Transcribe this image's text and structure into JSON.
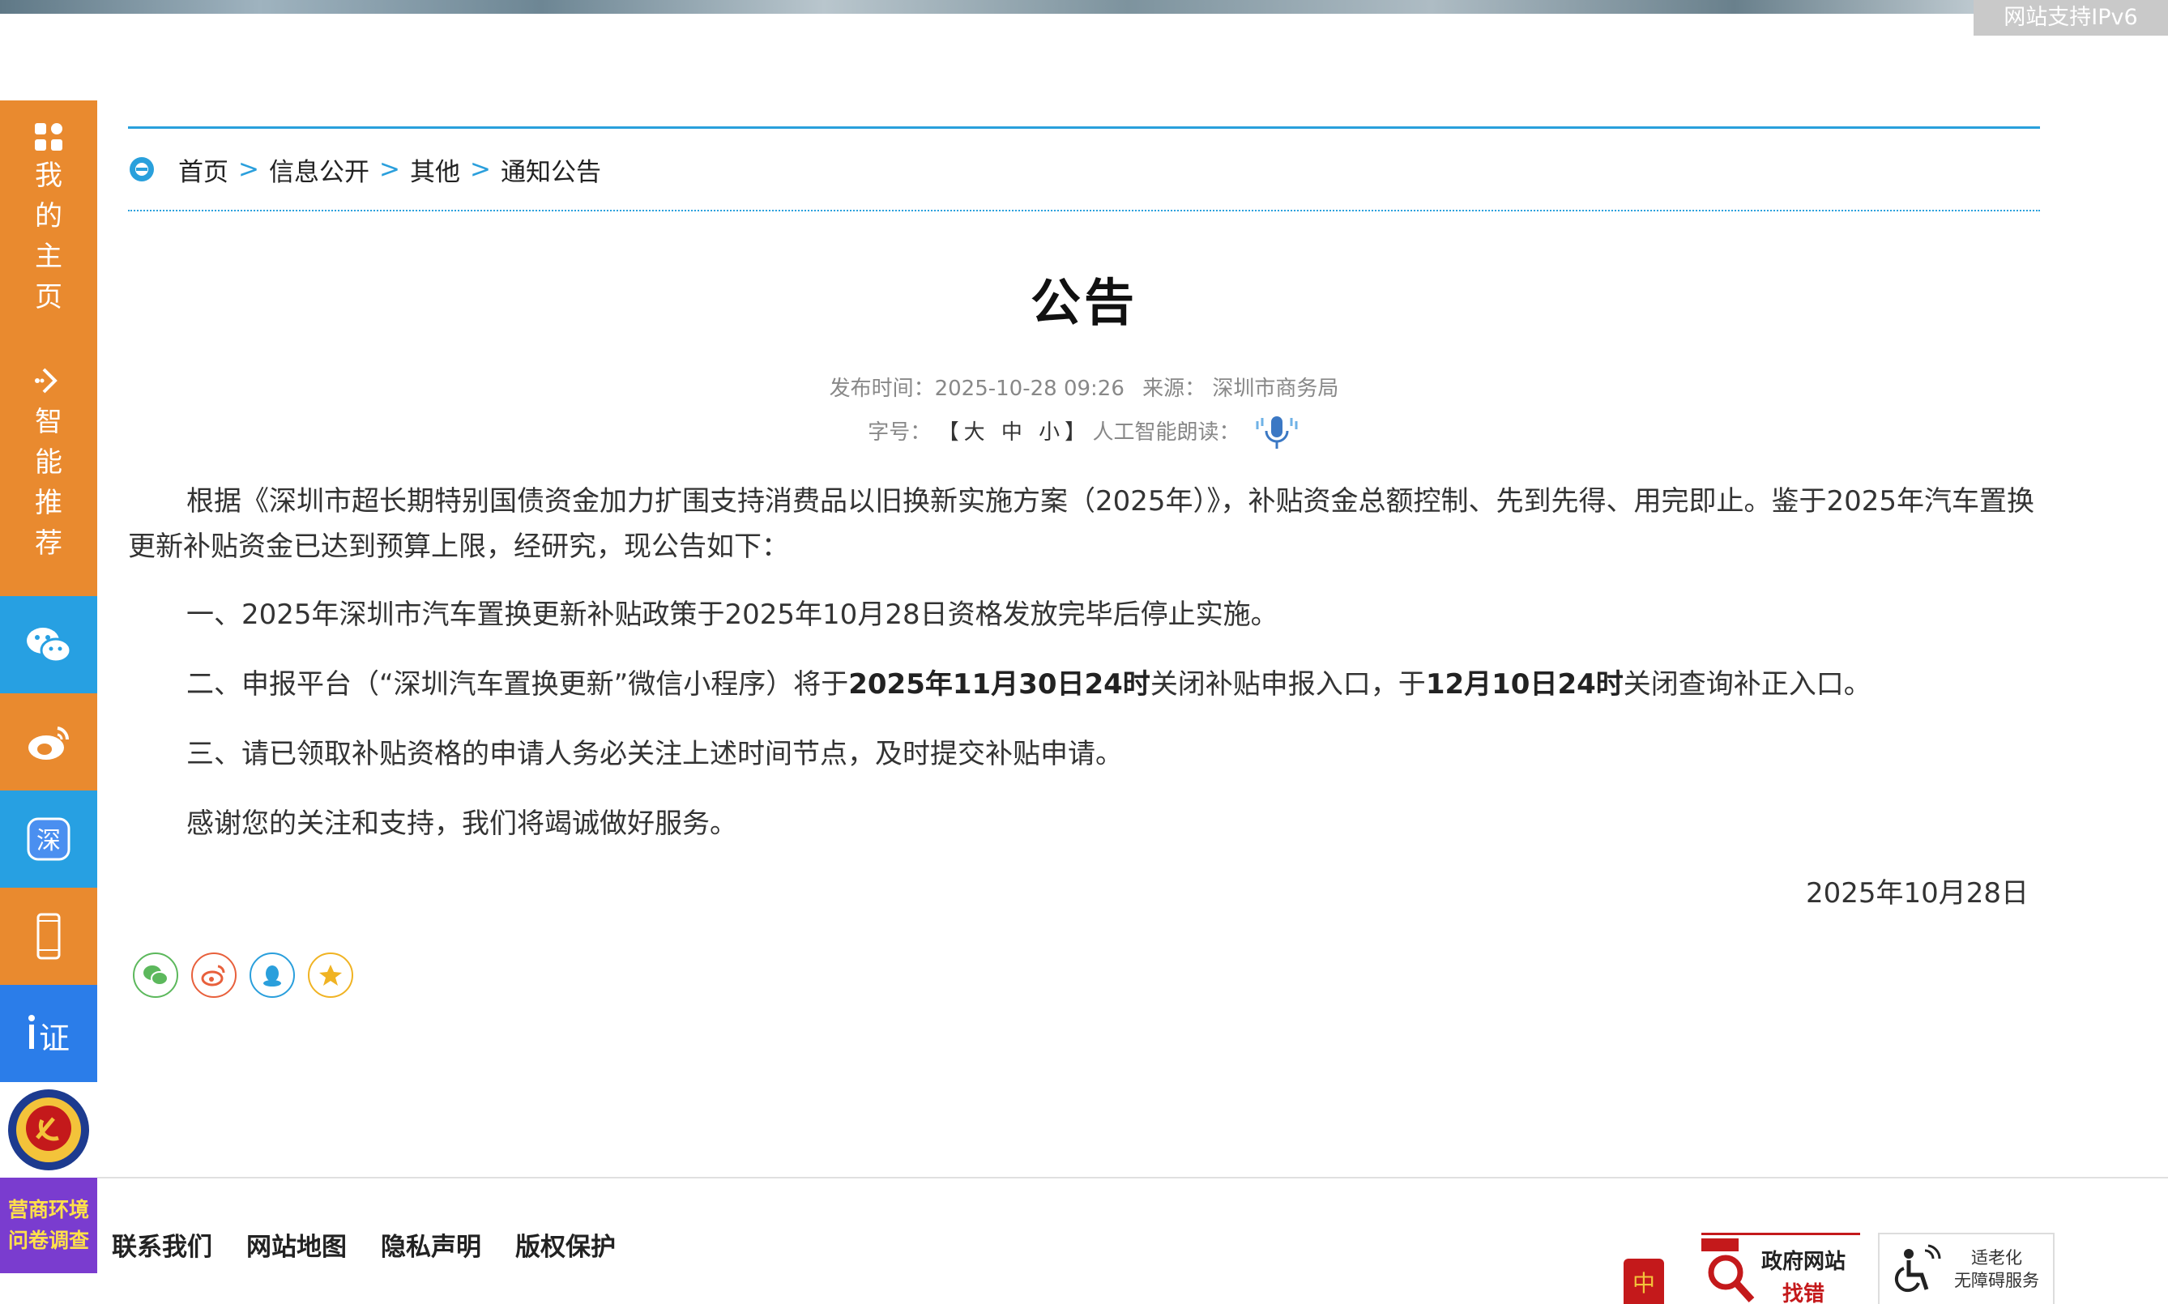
{
  "banner": {
    "ipv6": "网站支持IPv6"
  },
  "sidebar": {
    "home": "我的主页",
    "recommend": "智能推荐",
    "survey_line1": "营商环境",
    "survey_line2": "问卷调查"
  },
  "breadcrumb": [
    "首页",
    "信息公开",
    "其他",
    "通知公告"
  ],
  "article": {
    "title": "公告",
    "publish_label": "发布时间：",
    "publish_time": "2025-10-28 09:26",
    "source_label": "来源：",
    "source": "深圳市商务局",
    "font_label": "字号：",
    "font_open": "【",
    "font_large": "大",
    "font_medium": "中",
    "font_small": "小",
    "font_close": "】",
    "ai_read": "人工智能朗读：",
    "para1": "根据《深圳市超长期特别国债资金加力扩围支持消费品以旧换新实施方案（2025年）》，补贴资金总额控制、先到先得、用完即止。鉴于2025年汽车置换更新补贴资金已达到预算上限，经研究，现公告如下：",
    "para2": "一、2025年深圳市汽车置换更新补贴政策于2025年10月28日资格发放完毕后停止实施。",
    "para3_a": "二、申报平台（“深圳汽车置换更新”微信小程序）将于",
    "para3_b": "2025年11月30日24时",
    "para3_c": "关闭补贴申报入口，于",
    "para3_d": "12月10日24时",
    "para3_e": "关闭查询补正入口。",
    "para4": "三、请已领取补贴资格的申请人务必关注上述时间节点，及时提交补贴申请。",
    "para5": "感谢您的关注和支持，我们将竭诚做好服务。",
    "date": "2025年10月28日"
  },
  "share": [
    "wechat-icon",
    "weibo-icon",
    "qq-icon",
    "favorite-icon"
  ],
  "footer": {
    "links": [
      "联系我们",
      "网站地图",
      "隐私声明",
      "版权保护"
    ],
    "badge_zfwz_1": "政府网站",
    "badge_zfwz_2": "找错",
    "badge_old_1": "适老化",
    "badge_old_2": "无障碍服务"
  },
  "colors": {
    "accent": "#29a0dc",
    "sidebar_orange": "#e98a2f",
    "sidebar_blue": "#27a0e2",
    "survey_purple": "#7a3ccf"
  }
}
